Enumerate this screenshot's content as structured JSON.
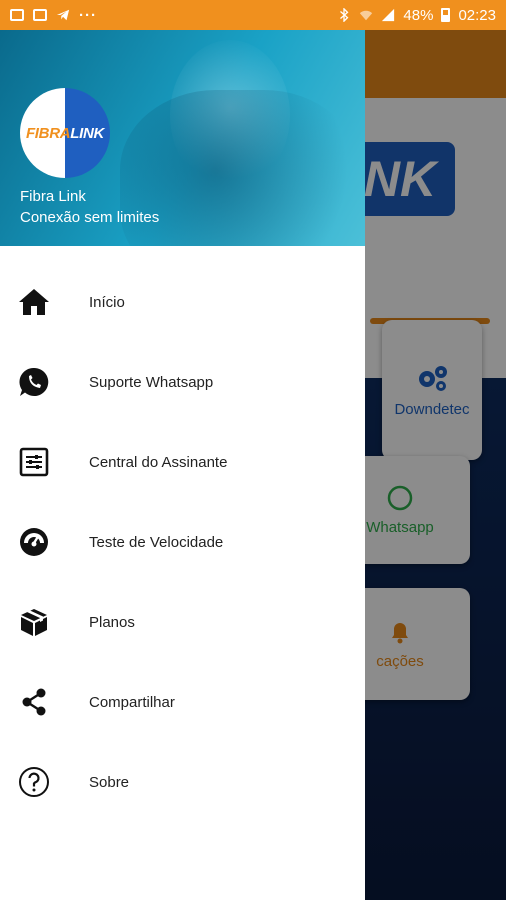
{
  "status_bar": {
    "battery": "48%",
    "time": "02:23"
  },
  "background_app": {
    "logo_text": "NK",
    "cards": [
      {
        "label": "Downdetec",
        "icon": "gears-icon"
      },
      {
        "label": "Whatsapp",
        "icon": "whatsapp-icon"
      },
      {
        "label": "cações",
        "icon": "bell-icon"
      }
    ]
  },
  "drawer": {
    "header": {
      "logo_part1": "FIBRA",
      "logo_part2": "LINK",
      "title": "Fibra Link",
      "subtitle": "Conexão sem limites"
    },
    "items": [
      {
        "label": "Início",
        "icon": "home-icon"
      },
      {
        "label": "Suporte Whatsapp",
        "icon": "whatsapp-icon"
      },
      {
        "label": "Central do Assinante",
        "icon": "settings-sliders-icon"
      },
      {
        "label": "Teste de Velocidade",
        "icon": "speedometer-icon"
      },
      {
        "label": "Planos",
        "icon": "box-icon"
      },
      {
        "label": "Compartilhar",
        "icon": "share-icon"
      },
      {
        "label": "Sobre",
        "icon": "help-circle-icon"
      }
    ]
  },
  "colors": {
    "status_bar": "#f0901e",
    "brand_orange": "#e8891a",
    "brand_blue": "#1f5fc0",
    "header_teal": "#1aa2c6"
  }
}
